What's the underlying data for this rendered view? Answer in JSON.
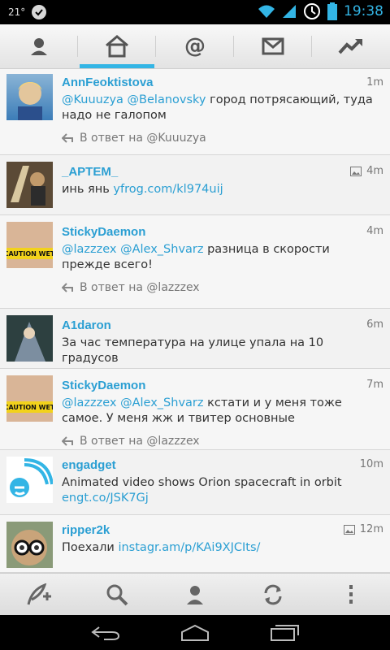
{
  "status_bar": {
    "temperature": "21°",
    "clock": "19:38",
    "icons": [
      "check-icon",
      "wifi-icon",
      "signal-icon",
      "alarm-icon",
      "battery-icon"
    ]
  },
  "top_tabs": [
    {
      "name": "profile",
      "icon": "person-icon",
      "active": false
    },
    {
      "name": "home",
      "icon": "home-icon",
      "active": true
    },
    {
      "name": "mentions",
      "icon": "at-icon",
      "active": false
    },
    {
      "name": "messages",
      "icon": "mail-icon",
      "active": false
    },
    {
      "name": "trends",
      "icon": "trend-icon",
      "active": false
    }
  ],
  "tweets": [
    {
      "handle": "AnnFeoktistova",
      "time": "1m",
      "mentions": "@Kuuuzya @Belanovsky",
      "text": "город потрясающий, туда надо не галопом",
      "reply": "В ответ на @Kuuuzya"
    },
    {
      "handle": "_APTEM_",
      "time": "4m",
      "text": "инь янь",
      "link": "yfrog.com/kl974uij",
      "has_image": true
    },
    {
      "handle": "StickyDaemon",
      "time": "4m",
      "mentions": "@lazzzex @Alex_Shvarz",
      "text": "разница в скорости прежде всего!",
      "reply": "В ответ на @lazzzex",
      "avatar_caption": "CAUTION WET"
    },
    {
      "handle": "A1daron",
      "time": "6m",
      "text": "За час температура на улице упала на 10 градусов"
    },
    {
      "handle": "StickyDaemon",
      "time": "7m",
      "mentions": "@lazzzex @Alex_Shvarz",
      "text": "кстати и у меня тоже самое. У меня жж и твитер основные",
      "reply": "В ответ на @lazzzex",
      "avatar_caption": "CAUTION WET"
    },
    {
      "handle": "engadget",
      "time": "10m",
      "text": "Animated video shows Orion spacecraft in orbit",
      "link": "engt.co/JSK7Gj"
    },
    {
      "handle": "ripper2k",
      "time": "12m",
      "text": "Поехали",
      "link": "instagr.am/p/KAi9XJCIts/",
      "has_image": true
    }
  ],
  "bottom_bar": [
    "compose-icon",
    "search-icon",
    "account-icon",
    "refresh-icon",
    "overflow-icon"
  ],
  "system_nav": [
    "back-icon",
    "home-icon",
    "recents-icon"
  ]
}
